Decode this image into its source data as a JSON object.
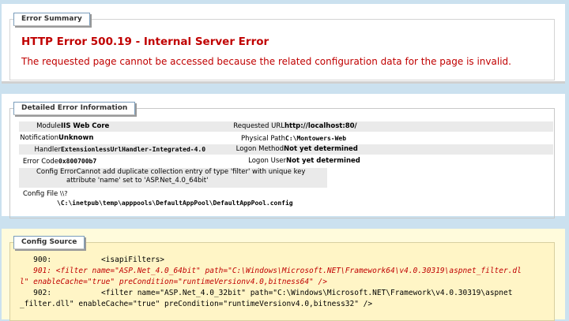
{
  "summary": {
    "legend": "Error Summary",
    "title": "HTTP Error 500.19 - Internal Server Error",
    "description": "The requested page cannot be accessed because the related configuration data for the page is invalid."
  },
  "details": {
    "legend": "Detailed Error Information",
    "module_label": "Module",
    "module_value": "IIS Web Core",
    "notification_label": "Notification",
    "notification_value": "Unknown",
    "handler_label": "Handler",
    "handler_value": "ExtensionlessUrlHandler-Integrated-4.0",
    "error_code_label": "Error Code",
    "error_code_value": "0x800700b7",
    "config_error_label": "Config Error",
    "config_error_line1": "Cannot add duplicate collection entry of type 'filter' with unique key",
    "config_error_line2": "attribute 'name' set to 'ASP.Net_4.0_64bit'",
    "config_file_label": "Config File",
    "config_file_value_line1": "\\\\?",
    "config_file_value_line2": "\\C:\\inetpub\\temp\\apppools\\DefaultAppPool\\DefaultAppPool.config",
    "requested_url_label": "Requested URL",
    "requested_url_value": "http://localhost:80/",
    "physical_path_label": "Physical Path",
    "physical_path_value": "C:\\Montowers-Web",
    "logon_method_label": "Logon Method",
    "logon_method_value": "Not yet determined",
    "logon_user_label": "Logon User",
    "logon_user_value": "Not yet determined"
  },
  "source": {
    "legend": "Config Source",
    "lines": [
      "   900:           <isapiFilters>",
      "   901: <filter name=\"ASP.Net_4.0_64bit\" path=\"C:\\Windows\\Microsoft.NET\\Framework64\\v4.0.30319\\aspnet_filter.dl",
      "l\" enableCache=\"true\" preCondition=\"runtimeVersionv4.0,bitness64\" />",
      "   902:           <filter name=\"ASP.Net_4.0_32bit\" path=\"C:\\Windows\\Microsoft.NET\\Framework\\v4.0.30319\\aspnet",
      "_filter.dll\" enableCache=\"true\" preCondition=\"runtimeVersionv4.0,bitness32\" />"
    ]
  },
  "colors": {
    "error_red": "#c00000",
    "background_blue": "#cbe1ef",
    "source_yellow": "#fff5c6"
  }
}
